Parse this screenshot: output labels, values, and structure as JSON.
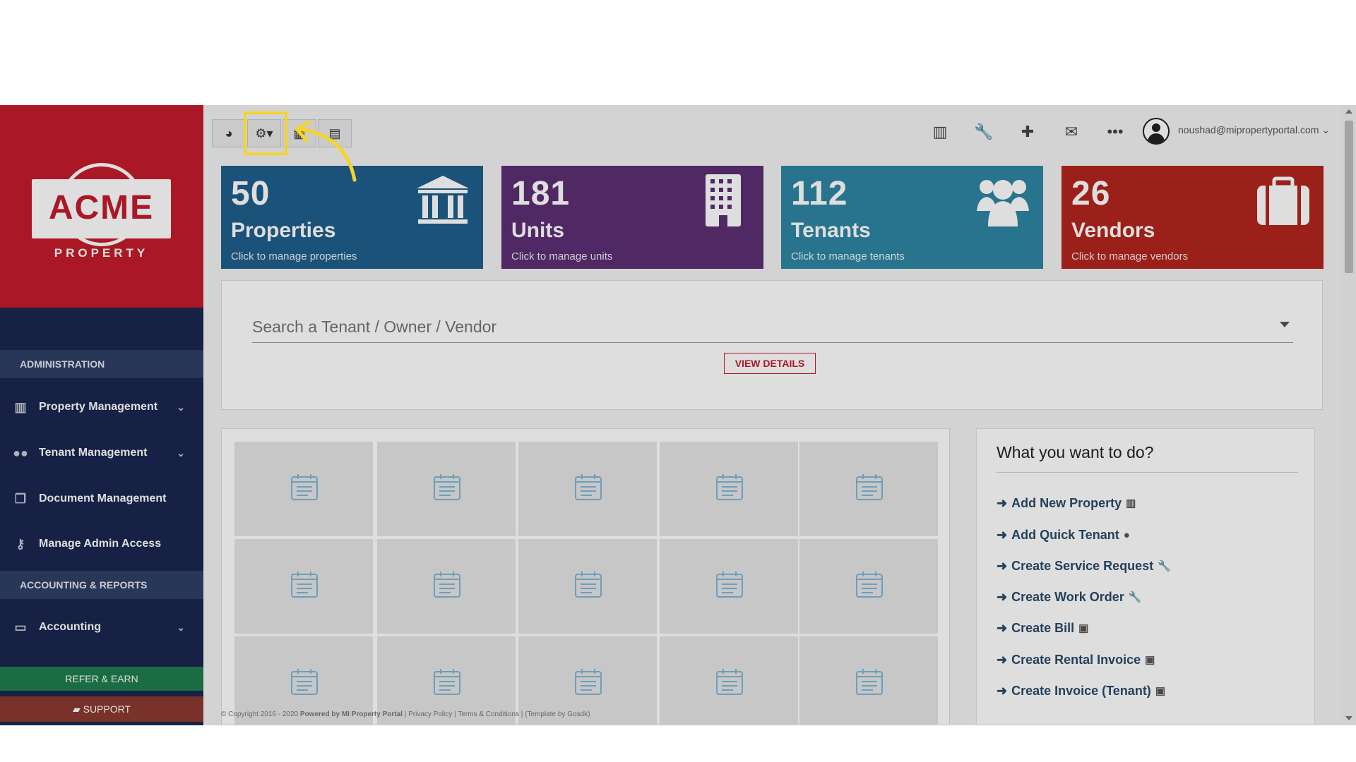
{
  "brand": {
    "logo_text": "ACME",
    "logo_sub": "PROPERTY",
    "primary_red": "#c41c2c",
    "sidebar_navy": "#1a2650"
  },
  "sidebar": {
    "sections": [
      {
        "title": "ADMINISTRATION"
      },
      {
        "title": "ACCOUNTING & REPORTS"
      }
    ],
    "items": [
      {
        "label": "Property Management",
        "icon": "building-icon",
        "has_submenu": true
      },
      {
        "label": "Tenant Management",
        "icon": "users-icon",
        "has_submenu": true
      },
      {
        "label": "Document Management",
        "icon": "documents-icon",
        "has_submenu": false
      },
      {
        "label": "Manage Admin Access",
        "icon": "key-icon",
        "has_submenu": false
      },
      {
        "label": "Accounting",
        "icon": "money-icon",
        "has_submenu": true
      }
    ],
    "refer_label": "REFER & EARN",
    "support_label": "SUPPORT"
  },
  "toolbar": {
    "buttons": [
      {
        "icon": "dashboard-icon",
        "glyph": "◕"
      },
      {
        "icon": "gear-icon",
        "glyph": "⚙▾"
      },
      {
        "icon": "calendar-icon",
        "glyph": "▦"
      },
      {
        "icon": "calculator-icon",
        "glyph": "▤"
      }
    ]
  },
  "header": {
    "icons": [
      {
        "name": "bar-chart-icon",
        "glyph": "▥"
      },
      {
        "name": "wrench-icon",
        "glyph": "🔧"
      },
      {
        "name": "plus-icon",
        "glyph": "✚"
      },
      {
        "name": "envelope-icon",
        "glyph": "✉"
      },
      {
        "name": "more-icon",
        "glyph": "•••"
      }
    ],
    "user_email": "noushad@mipropertyportal.com"
  },
  "stats": [
    {
      "value": "50",
      "title": "Properties",
      "subtitle": "Click to manage properties",
      "color": "#1f5f8c",
      "icon": "bank-icon"
    },
    {
      "value": "181",
      "title": "Units",
      "subtitle": "Click to manage units",
      "color": "#5c2e73",
      "icon": "apartment-icon"
    },
    {
      "value": "112",
      "title": "Tenants",
      "subtitle": "Click to manage tenants",
      "color": "#2e86a4",
      "icon": "people-icon"
    },
    {
      "value": "26",
      "title": "Vendors",
      "subtitle": "Click to manage vendors",
      "color": "#b3251d",
      "icon": "briefcase-icon"
    }
  ],
  "search": {
    "placeholder": "Search a Tenant / Owner / Vendor",
    "button_label": "VIEW DETAILS"
  },
  "actions": {
    "title": "What you want to do?",
    "items": [
      {
        "label": "Add New Property",
        "icon": "building-icon",
        "glyph": "▥"
      },
      {
        "label": "Add Quick Tenant",
        "icon": "user-icon",
        "glyph": "●"
      },
      {
        "label": "Create Service Request",
        "icon": "wrench-icon",
        "glyph": "🔧"
      },
      {
        "label": "Create Work Order",
        "icon": "wrench-icon",
        "glyph": "🔧"
      },
      {
        "label": "Create Bill",
        "icon": "copy-icon",
        "glyph": "▣"
      },
      {
        "label": "Create Rental Invoice",
        "icon": "copy-icon",
        "glyph": "▣"
      },
      {
        "label": "Create Invoice (Tenant)",
        "icon": "copy-icon",
        "glyph": "▣"
      }
    ]
  },
  "footer": {
    "copyright": "© Copyright 2016 - 2020",
    "powered": "Powered by MI Property Portal",
    "links": [
      "Privacy Policy",
      "Terms & Conditions"
    ],
    "template_note": "(Template by Gosdk)"
  }
}
